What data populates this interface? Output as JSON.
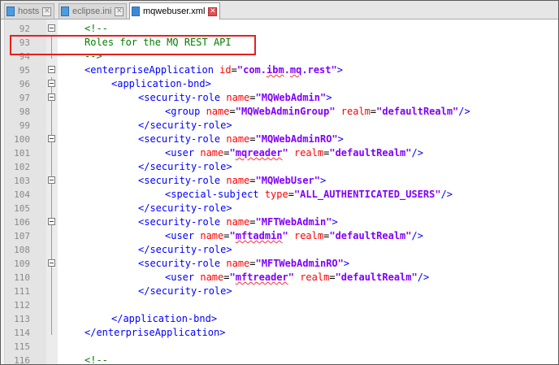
{
  "tabs": [
    {
      "label": "hosts",
      "active": false
    },
    {
      "label": "eclipse.ini",
      "active": false
    },
    {
      "label": "mqwebuser.xml",
      "active": true
    }
  ],
  "close_glyph": "✕",
  "lines": [
    {
      "num": "92",
      "text": "<!--"
    },
    {
      "num": "93",
      "text": "Roles for the MQ REST API"
    },
    {
      "num": "94",
      "text": "-->"
    },
    {
      "num": "95",
      "text": "<enterpriseApplication id=\"com.ibm.mq.rest\">"
    },
    {
      "num": "96",
      "text": "<application-bnd>"
    },
    {
      "num": "97",
      "text": "<security-role name=\"MQWebAdmin\">"
    },
    {
      "num": "98",
      "text": "<group name=\"MQWebAdminGroup\" realm=\"defaultRealm\"/>"
    },
    {
      "num": "99",
      "text": "</security-role>"
    },
    {
      "num": "100",
      "text": "<security-role name=\"MQWebAdminRO\">"
    },
    {
      "num": "101",
      "text": "<user name=\"mqreader\" realm=\"defaultRealm\"/>"
    },
    {
      "num": "102",
      "text": "</security-role>"
    },
    {
      "num": "103",
      "text": "<security-role name=\"MQWebUser\">"
    },
    {
      "num": "104",
      "text": "<special-subject type=\"ALL_AUTHENTICATED_USERS\"/>"
    },
    {
      "num": "105",
      "text": "</security-role>"
    },
    {
      "num": "106",
      "text": "<security-role name=\"MFTWebAdmin\">"
    },
    {
      "num": "107",
      "text": "<user name=\"mftadmin\" realm=\"defaultRealm\"/>"
    },
    {
      "num": "108",
      "text": "</security-role>"
    },
    {
      "num": "109",
      "text": "<security-role name=\"MFTWebAdminRO\">"
    },
    {
      "num": "110",
      "text": "<user name=\"mftreader\" realm=\"defaultRealm\"/>"
    },
    {
      "num": "111",
      "text": "</security-role>"
    },
    {
      "num": "112",
      "text": ""
    },
    {
      "num": "113",
      "text": "</application-bnd>"
    },
    {
      "num": "114",
      "text": "</enterpriseApplication>"
    },
    {
      "num": "115",
      "text": ""
    },
    {
      "num": "116",
      "text": "<!--"
    }
  ],
  "colors": {
    "comment": "#008000",
    "tag": "#0000ff",
    "attribute": "#ff0000",
    "value": "#8000ff",
    "highlight_box": "#e8201e"
  }
}
